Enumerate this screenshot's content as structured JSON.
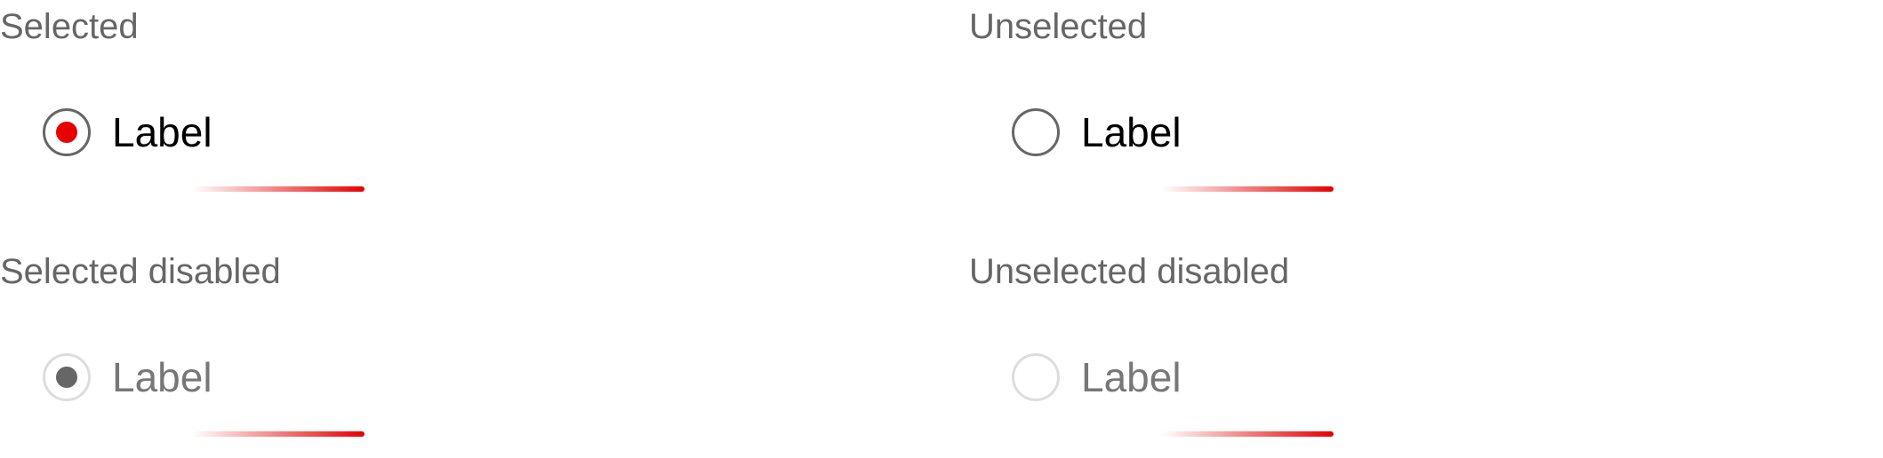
{
  "colors": {
    "accent": "#e60000",
    "title_text": "#666666",
    "label_text": "#000000",
    "disabled_text": "#777777",
    "disabled_border": "#dddddd",
    "disabled_dot": "#666666"
  },
  "states": [
    {
      "title": "Selected",
      "label": "Label",
      "selected": true,
      "disabled": false
    },
    {
      "title": "Unselected",
      "label": "Label",
      "selected": false,
      "disabled": false
    },
    {
      "title": "Selected disabled",
      "label": "Label",
      "selected": true,
      "disabled": true
    },
    {
      "title": "Unselected disabled",
      "label": "Label",
      "selected": false,
      "disabled": true
    }
  ]
}
